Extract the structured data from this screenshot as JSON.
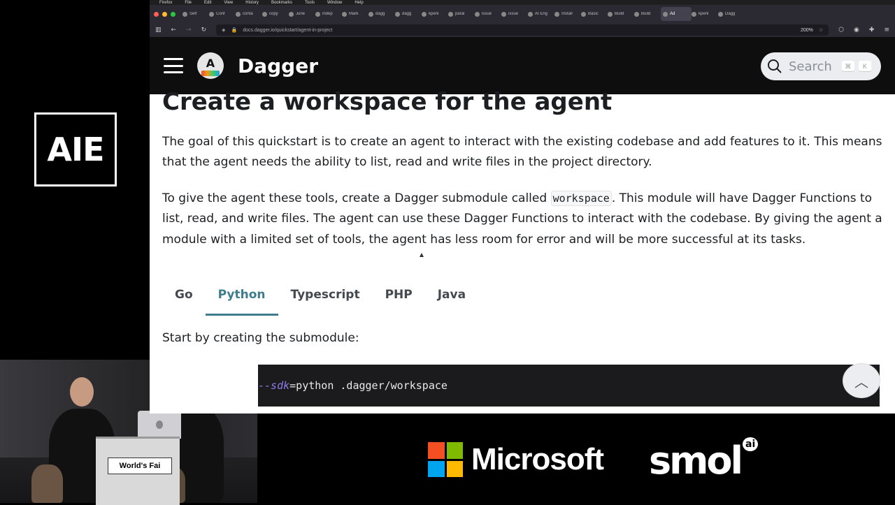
{
  "stage": {
    "logo_text": "AIE",
    "podium_sign": "World's Fai",
    "sponsors": {
      "microsoft": "Microsoft",
      "smol": "smol",
      "smol_sup": "ai"
    }
  },
  "browser": {
    "menubar": [
      "Firefox",
      "File",
      "Edit",
      "View",
      "History",
      "Bookmarks",
      "Tools",
      "Window",
      "Help"
    ],
    "tabs": [
      "Self",
      "Conf",
      "conta",
      "copy",
      "June",
      "indep",
      "Mark",
      "dagg",
      "dagg",
      "kpenl",
      "paral",
      "issue",
      "issue",
      "AI Eng",
      "Install",
      "Basic",
      "Build",
      "Build",
      "Ad",
      "kpenl",
      "Dagg"
    ],
    "active_tab_index": 18,
    "url": "docs.dagger.io/quickstart/agent-in-project",
    "zoom": "200%"
  },
  "site": {
    "title": "Dagger",
    "search_placeholder": "Search",
    "kbd_keys": [
      "⌘",
      "K"
    ]
  },
  "article": {
    "heading": "Create a workspace for the agent",
    "para1": "The goal of this quickstart is to create an agent to interact with the existing codebase and add features to it. This means that the agent needs the ability to list, read and write files in the project directory.",
    "para2_before": "To give the agent these tools, create a Dagger submodule called ",
    "para2_code": "workspace",
    "para2_after": ". This module will have Dagger Functions to list, read, and write files. The agent can use these Dagger Functions to interact with the codebase. By giving the agent a module with a limited set of tools, the agent has less room for error and will be more successful at its tasks.",
    "lang_tabs": [
      "Go",
      "Python",
      "Typescript",
      "PHP",
      "Java"
    ],
    "active_lang": "Python",
    "start_text": "Start by creating the submodule:",
    "code_flag": "--sdk",
    "code_rest": "=python .dagger/workspace"
  },
  "colors": {
    "accent": "#3e7d8d",
    "header_bg": "#0e0e0e",
    "code_bg": "#1b1b1d"
  }
}
